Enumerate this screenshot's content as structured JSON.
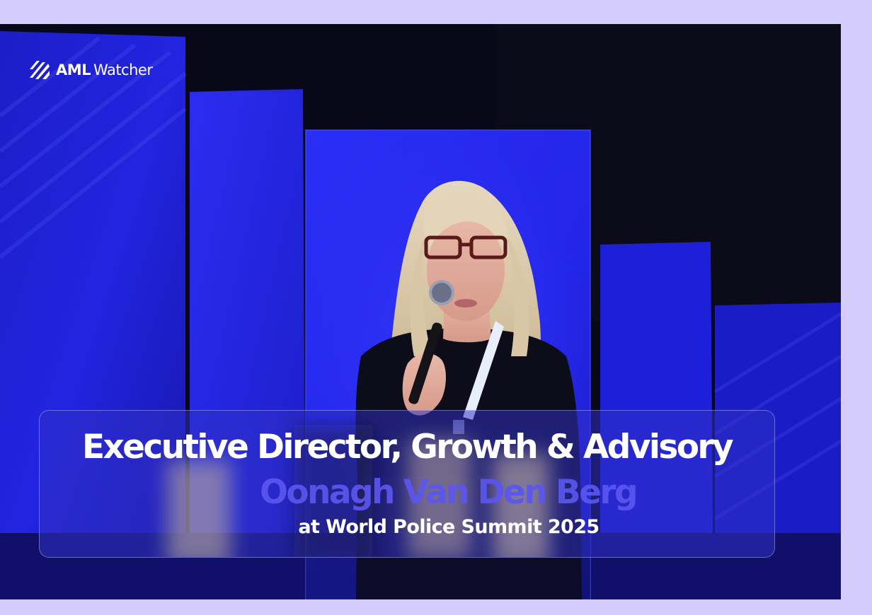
{
  "brand": {
    "logo_bold": "AML",
    "logo_light": "Watcher"
  },
  "caption": {
    "title": "Executive Director, Growth & Advisory",
    "name": "Oonagh Van Den Berg",
    "event": "at World Police Summit 2025"
  },
  "colors": {
    "page_background": "#d4cdfb",
    "stage_blue": "#1f22e6",
    "name_accent": "#5b56f0",
    "text_white": "#ffffff"
  },
  "icons": {
    "logo_mark": "diagonal-stripes-logo-icon"
  }
}
